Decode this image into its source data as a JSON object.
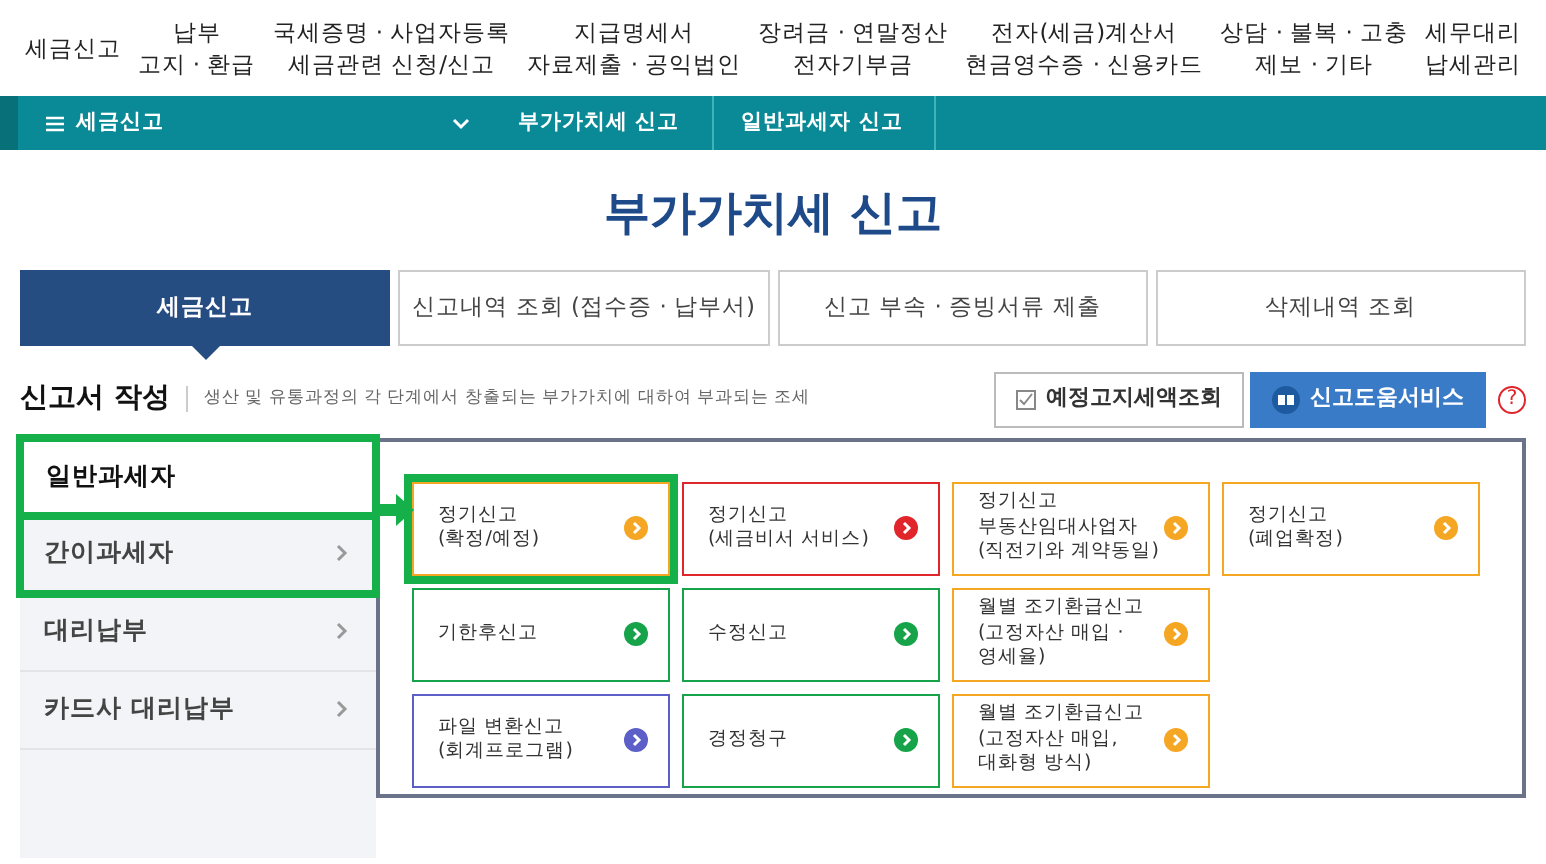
{
  "top_menu": [
    {
      "lines": [
        "세금신고"
      ]
    },
    {
      "lines": [
        "납부",
        "고지 · 환급"
      ]
    },
    {
      "lines": [
        "국세증명 · 사업자등록",
        "세금관련 신청/신고"
      ]
    },
    {
      "lines": [
        "지급명세서",
        "자료제출 · 공익법인"
      ]
    },
    {
      "lines": [
        "장려금 · 연말정산",
        "전자기부금"
      ]
    },
    {
      "lines": [
        "전자(세금)계산서",
        "현금영수증 · 신용카드"
      ]
    },
    {
      "lines": [
        "상담 · 불복 · 고충",
        "제보 · 기타"
      ]
    },
    {
      "lines": [
        "세무대리",
        "납세관리"
      ]
    }
  ],
  "breadcrumb": {
    "menu": "세금신고",
    "items": [
      "부가가치세 신고",
      "일반과세자 신고"
    ]
  },
  "page_title": "부가가치세 신고",
  "tabs": [
    {
      "label": "세금신고",
      "selected": true
    },
    {
      "label": "신고내역 조회 (접수증 · 납부서)",
      "selected": false
    },
    {
      "label": "신고 부속 · 증빙서류 제출",
      "selected": false
    },
    {
      "label": "삭제내역 조회",
      "selected": false
    }
  ],
  "section": {
    "title": "신고서 작성",
    "description": "생산 및 유통과정의 각 단계에서 창출되는 부가가치에 대하여 부과되는 조세"
  },
  "buttons": [
    {
      "label": "예정고지세액조회",
      "kind": "plain"
    },
    {
      "label": "신고도움서비스",
      "kind": "primary"
    }
  ],
  "help": "?",
  "sidebar": [
    {
      "label": "일반과세자",
      "selected": true,
      "highlighted": true
    },
    {
      "label": "간이과세자",
      "selected": false,
      "highlighted": true
    },
    {
      "label": "대리납부",
      "selected": false,
      "highlighted": false
    },
    {
      "label": "카드사 대리납부",
      "selected": false,
      "highlighted": false
    }
  ],
  "card_rows": [
    [
      {
        "lines": [
          "정기신고",
          "(확정/예정)"
        ],
        "color": "#f5a623",
        "highlighted": true
      },
      {
        "lines": [
          "정기신고",
          "(세금비서 서비스)"
        ],
        "color": "#e0252b",
        "highlighted": false
      },
      {
        "lines": [
          "정기신고",
          "부동산임대사업자",
          "(직전기와 계약동일)"
        ],
        "color": "#f5a623",
        "highlighted": false
      },
      {
        "lines": [
          "정기신고",
          "(폐업확정)"
        ],
        "color": "#f5a623",
        "highlighted": false
      }
    ],
    [
      {
        "lines": [
          "기한후신고"
        ],
        "color": "#16a34a",
        "highlighted": false
      },
      {
        "lines": [
          "수정신고"
        ],
        "color": "#16a34a",
        "highlighted": false
      },
      {
        "lines": [
          "월별 조기환급신고",
          "(고정자산 매입 ·",
          "영세율)"
        ],
        "color": "#f5a623",
        "highlighted": false
      }
    ],
    [
      {
        "lines": [
          "파일 변환신고",
          "(회계프로그램)"
        ],
        "color": "#5b5fc7",
        "highlighted": false
      },
      {
        "lines": [
          "경정청구"
        ],
        "color": "#16a34a",
        "highlighted": false
      },
      {
        "lines": [
          "월별 조기환급신고",
          "(고정자산 매입,",
          "대화형 방식)"
        ],
        "color": "#f5a623",
        "highlighted": false
      }
    ]
  ]
}
